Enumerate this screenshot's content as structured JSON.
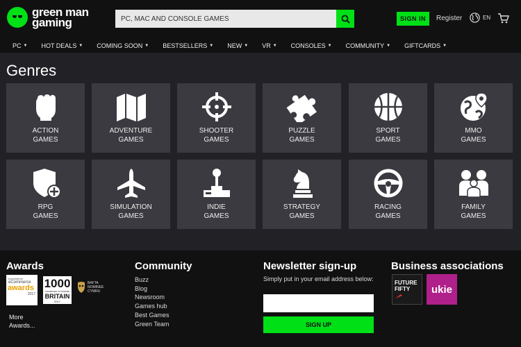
{
  "header": {
    "logo_line1": "green man",
    "logo_line2": "gaming",
    "search_placeholder": "PC, MAC AND CONSOLE GAMES",
    "signin_label": "SIGN IN",
    "register_label": "Register",
    "lang_label": "EN"
  },
  "nav": {
    "items": [
      {
        "label": "PC"
      },
      {
        "label": "HOT DEALS"
      },
      {
        "label": "COMING SOON"
      },
      {
        "label": "BESTSELLERS"
      },
      {
        "label": "NEW"
      },
      {
        "label": "VR"
      },
      {
        "label": "CONSOLES"
      },
      {
        "label": "COMMUNITY"
      },
      {
        "label": "GIFTCARDS"
      }
    ]
  },
  "main": {
    "title": "Genres",
    "genres": [
      {
        "line1": "ACTION",
        "line2": "GAMES",
        "icon": "fist-icon"
      },
      {
        "line1": "ADVENTURE",
        "line2": "GAMES",
        "icon": "map-icon"
      },
      {
        "line1": "SHOOTER",
        "line2": "GAMES",
        "icon": "crosshair-icon"
      },
      {
        "line1": "PUZZLE",
        "line2": "GAMES",
        "icon": "puzzle-icon"
      },
      {
        "line1": "SPORT",
        "line2": "GAMES",
        "icon": "basketball-icon"
      },
      {
        "line1": "MMO",
        "line2": "GAMES",
        "icon": "globe-pin-icon"
      },
      {
        "line1": "RPG",
        "line2": "GAMES",
        "icon": "shield-plus-icon"
      },
      {
        "line1": "SIMULATION",
        "line2": "GAMES",
        "icon": "airplane-icon"
      },
      {
        "line1": "INDIE",
        "line2": "GAMES",
        "icon": "joystick-icon"
      },
      {
        "line1": "STRATEGY",
        "line2": "GAMES",
        "icon": "chess-knight-icon"
      },
      {
        "line1": "RACING",
        "line2": "GAMES",
        "icon": "steering-wheel-icon"
      },
      {
        "line1": "FAMILY",
        "line2": "GAMES",
        "icon": "family-icon"
      }
    ]
  },
  "footer": {
    "awards_heading": "Awards",
    "awards": {
      "ecom_small": "ecommerce",
      "ecom_line1": "eCommerce",
      "ecom_line2": "awards",
      "ecom_year": "2017",
      "thousand_num": "1000",
      "thousand_text": "COMPANIES TO INSPIRE",
      "thousand_britain": "BRITAIN",
      "thousand_year": "2017",
      "bafta_line1": "BAFTA",
      "bafta_line2": "NOMINEE",
      "bafta_line3": "CYMRU"
    },
    "more_awards_line1": "More",
    "more_awards_line2": "Awards...",
    "community_heading": "Community",
    "community_links": [
      "Buzz",
      "Blog",
      "Newsroom",
      "Games hub",
      "Best Games",
      "Green Team"
    ],
    "newsletter_heading": "Newsletter sign-up",
    "newsletter_desc": "Simply put in your email address below:",
    "newsletter_button": "SIGN UP",
    "business_heading": "Business associations",
    "business": {
      "ff_line1": "FUTURE",
      "ff_line2": "FIFTY",
      "ukie": "ukie"
    }
  },
  "colors": {
    "accent": "#00e016",
    "tile": "#3a3a40",
    "main_bg": "#222226",
    "header_bg": "#111111",
    "ukie": "#b0208a"
  }
}
